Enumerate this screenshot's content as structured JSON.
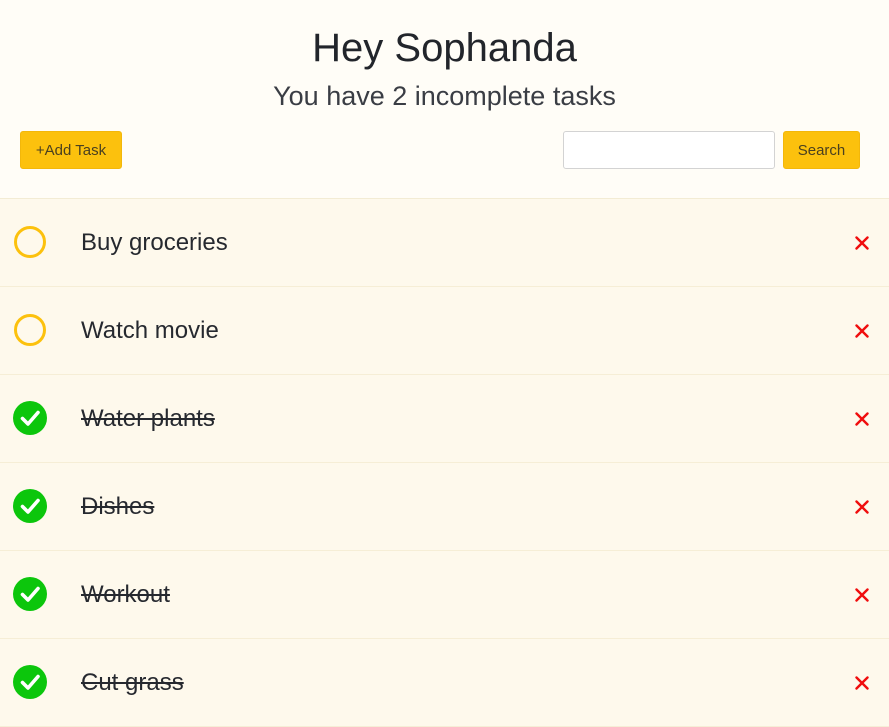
{
  "header": {
    "greeting": "Hey Sophanda",
    "subtitle": "You have 2 incomplete tasks",
    "add_task_label": "+Add Task",
    "search_placeholder": "",
    "search_value": "",
    "search_label": "Search"
  },
  "colors": {
    "accent": "#fcc10d",
    "pending_ring": "#fcc10d",
    "done_check": "#0cc60c",
    "delete": "#f00d0d"
  },
  "tasks": [
    {
      "label": "Buy groceries",
      "completed": false,
      "status_icon": "circle-outline-icon",
      "delete_icon": "close-icon"
    },
    {
      "label": "Watch movie",
      "completed": false,
      "status_icon": "circle-outline-icon",
      "delete_icon": "close-icon"
    },
    {
      "label": "Water plants",
      "completed": true,
      "status_icon": "check-circle-icon",
      "delete_icon": "close-icon"
    },
    {
      "label": "Dishes",
      "completed": true,
      "status_icon": "check-circle-icon",
      "delete_icon": "close-icon"
    },
    {
      "label": "Workout",
      "completed": true,
      "status_icon": "check-circle-icon",
      "delete_icon": "close-icon"
    },
    {
      "label": "Cut grass",
      "completed": true,
      "status_icon": "check-circle-icon",
      "delete_icon": "close-icon"
    }
  ]
}
